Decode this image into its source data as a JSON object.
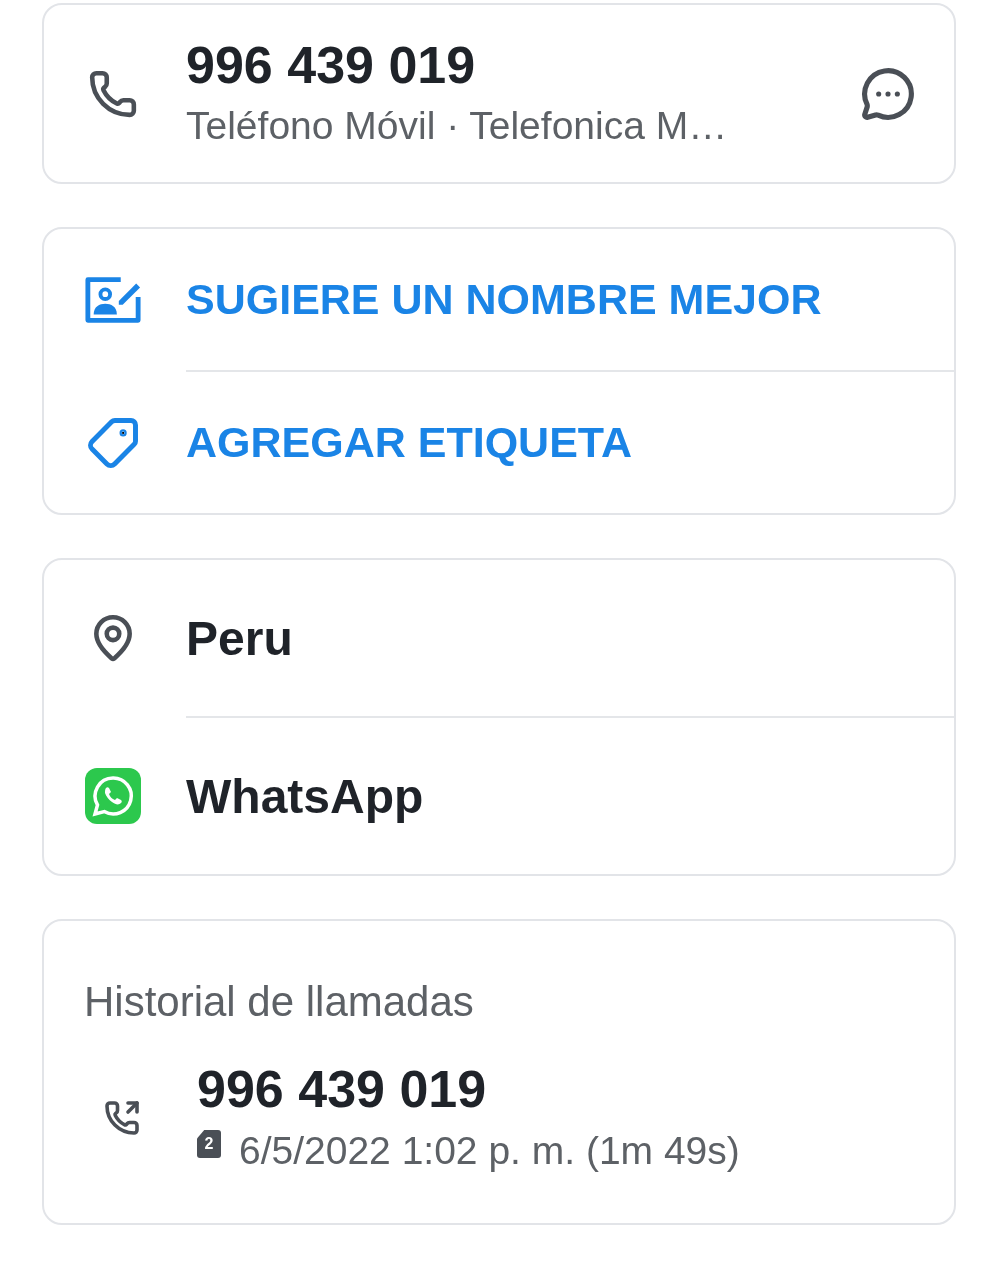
{
  "contact": {
    "number": "996 439 019",
    "subtitle": "Teléfono Móvil · Telefonica M…"
  },
  "actions": [
    {
      "kind": "rename",
      "label": "SUGIERE UN NOMBRE MEJOR"
    },
    {
      "kind": "tag",
      "label": "AGREGAR ETIQUETA"
    }
  ],
  "info": [
    {
      "kind": "location",
      "label": "Peru"
    },
    {
      "kind": "whatsapp",
      "label": "WhatsApp"
    }
  ],
  "call_history": {
    "title": "Historial de llamadas",
    "entries": [
      {
        "kind": "outgoing",
        "number": "996 439 019",
        "sim": "2",
        "details": "6/5/2022 1:02 p. m. (1m 49s)"
      }
    ]
  }
}
